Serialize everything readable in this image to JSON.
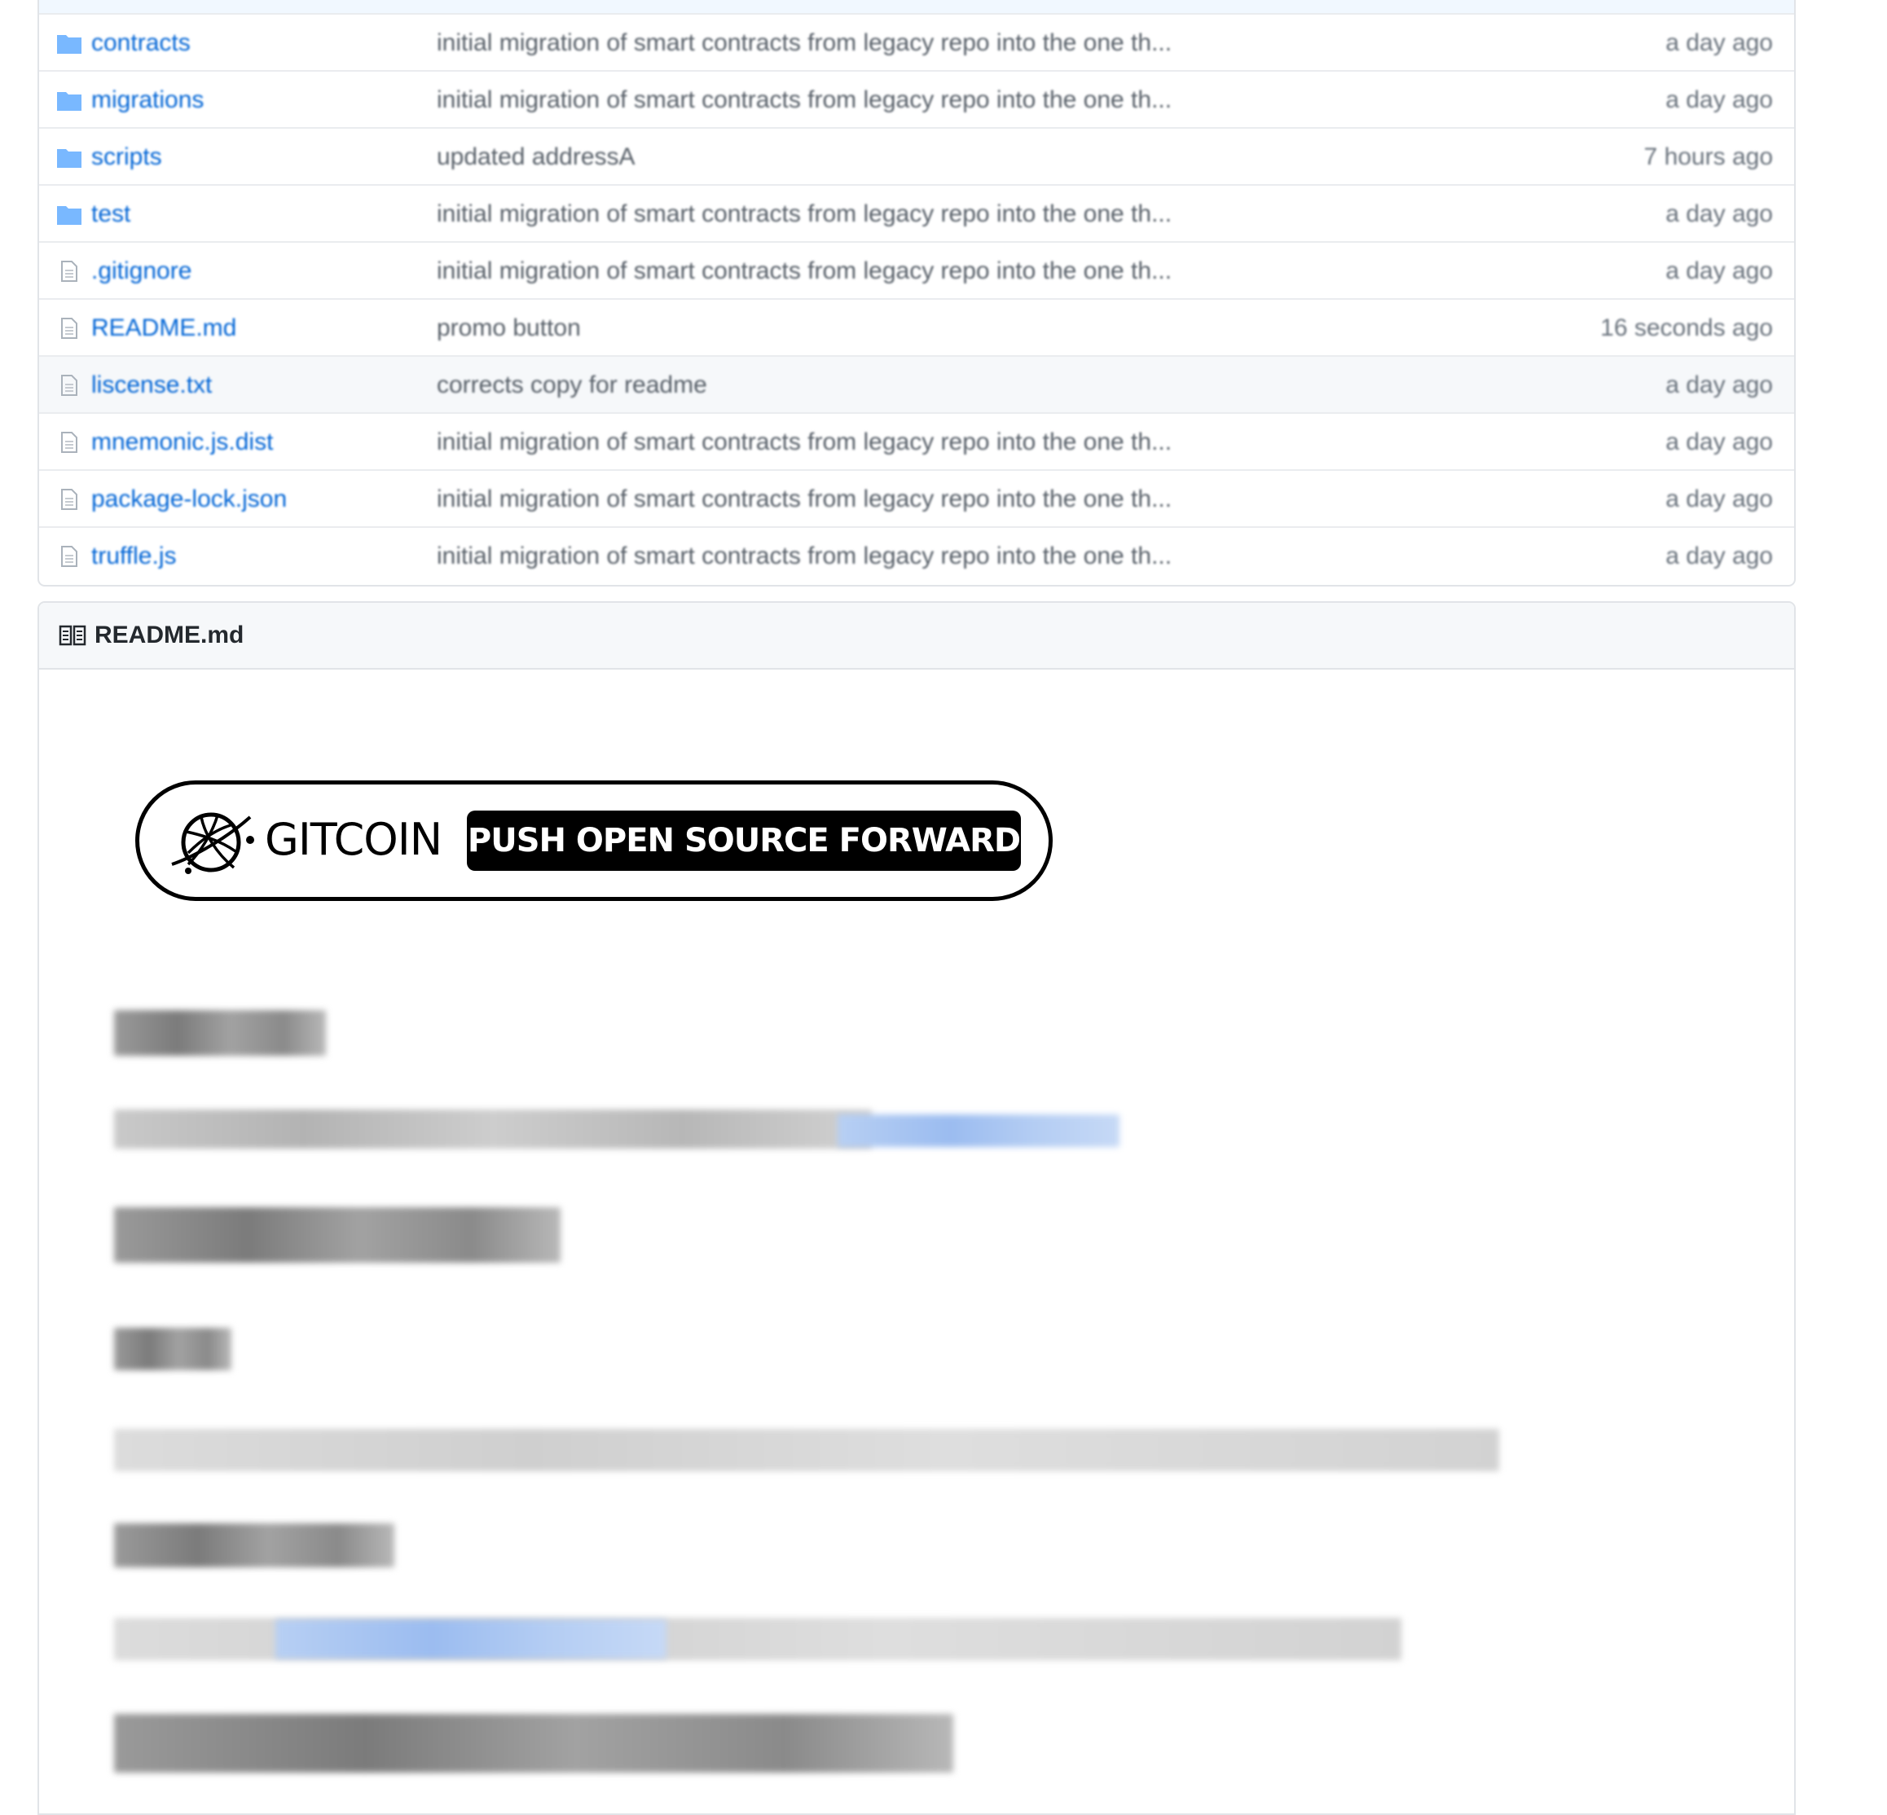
{
  "files": [
    {
      "type": "folder",
      "name": "contracts",
      "message": "initial migration of smart contracts from legacy repo into the one th...",
      "age": "a day ago"
    },
    {
      "type": "folder",
      "name": "migrations",
      "message": "initial migration of smart contracts from legacy repo into the one th...",
      "age": "a day ago"
    },
    {
      "type": "folder",
      "name": "scripts",
      "message": "updated addressA",
      "age": "7 hours ago"
    },
    {
      "type": "folder",
      "name": "test",
      "message": "initial migration of smart contracts from legacy repo into the one th...",
      "age": "a day ago"
    },
    {
      "type": "file",
      "name": ".gitignore",
      "message": "initial migration of smart contracts from legacy repo into the one th...",
      "age": "a day ago"
    },
    {
      "type": "file",
      "name": "README.md",
      "message": "promo button",
      "age": "16 seconds ago"
    },
    {
      "type": "file",
      "name": "liscense.txt",
      "message": "corrects copy for readme",
      "age": "a day ago"
    },
    {
      "type": "file",
      "name": "mnemonic.js.dist",
      "message": "initial migration of smart contracts from legacy repo into the one th...",
      "age": "a day ago"
    },
    {
      "type": "file",
      "name": "package-lock.json",
      "message": "initial migration of smart contracts from legacy repo into the one th...",
      "age": "a day ago"
    },
    {
      "type": "file",
      "name": "truffle.js",
      "message": "initial migration of smart contracts from legacy repo into the one th...",
      "age": "a day ago"
    }
  ],
  "readme": {
    "title": "README.md",
    "banner": {
      "wordmark": "GITCOIN",
      "button": "PUSH OPEN SOURCE FORWARD"
    }
  },
  "colors": {
    "link": "#0366d6",
    "muted": "#586069",
    "border": "#e1e4e8",
    "header_bg": "#f6f8fa"
  },
  "icons": {
    "folder": "folder-icon",
    "file": "file-icon",
    "readme": "book-icon",
    "logo": "gitcoin-logo"
  }
}
